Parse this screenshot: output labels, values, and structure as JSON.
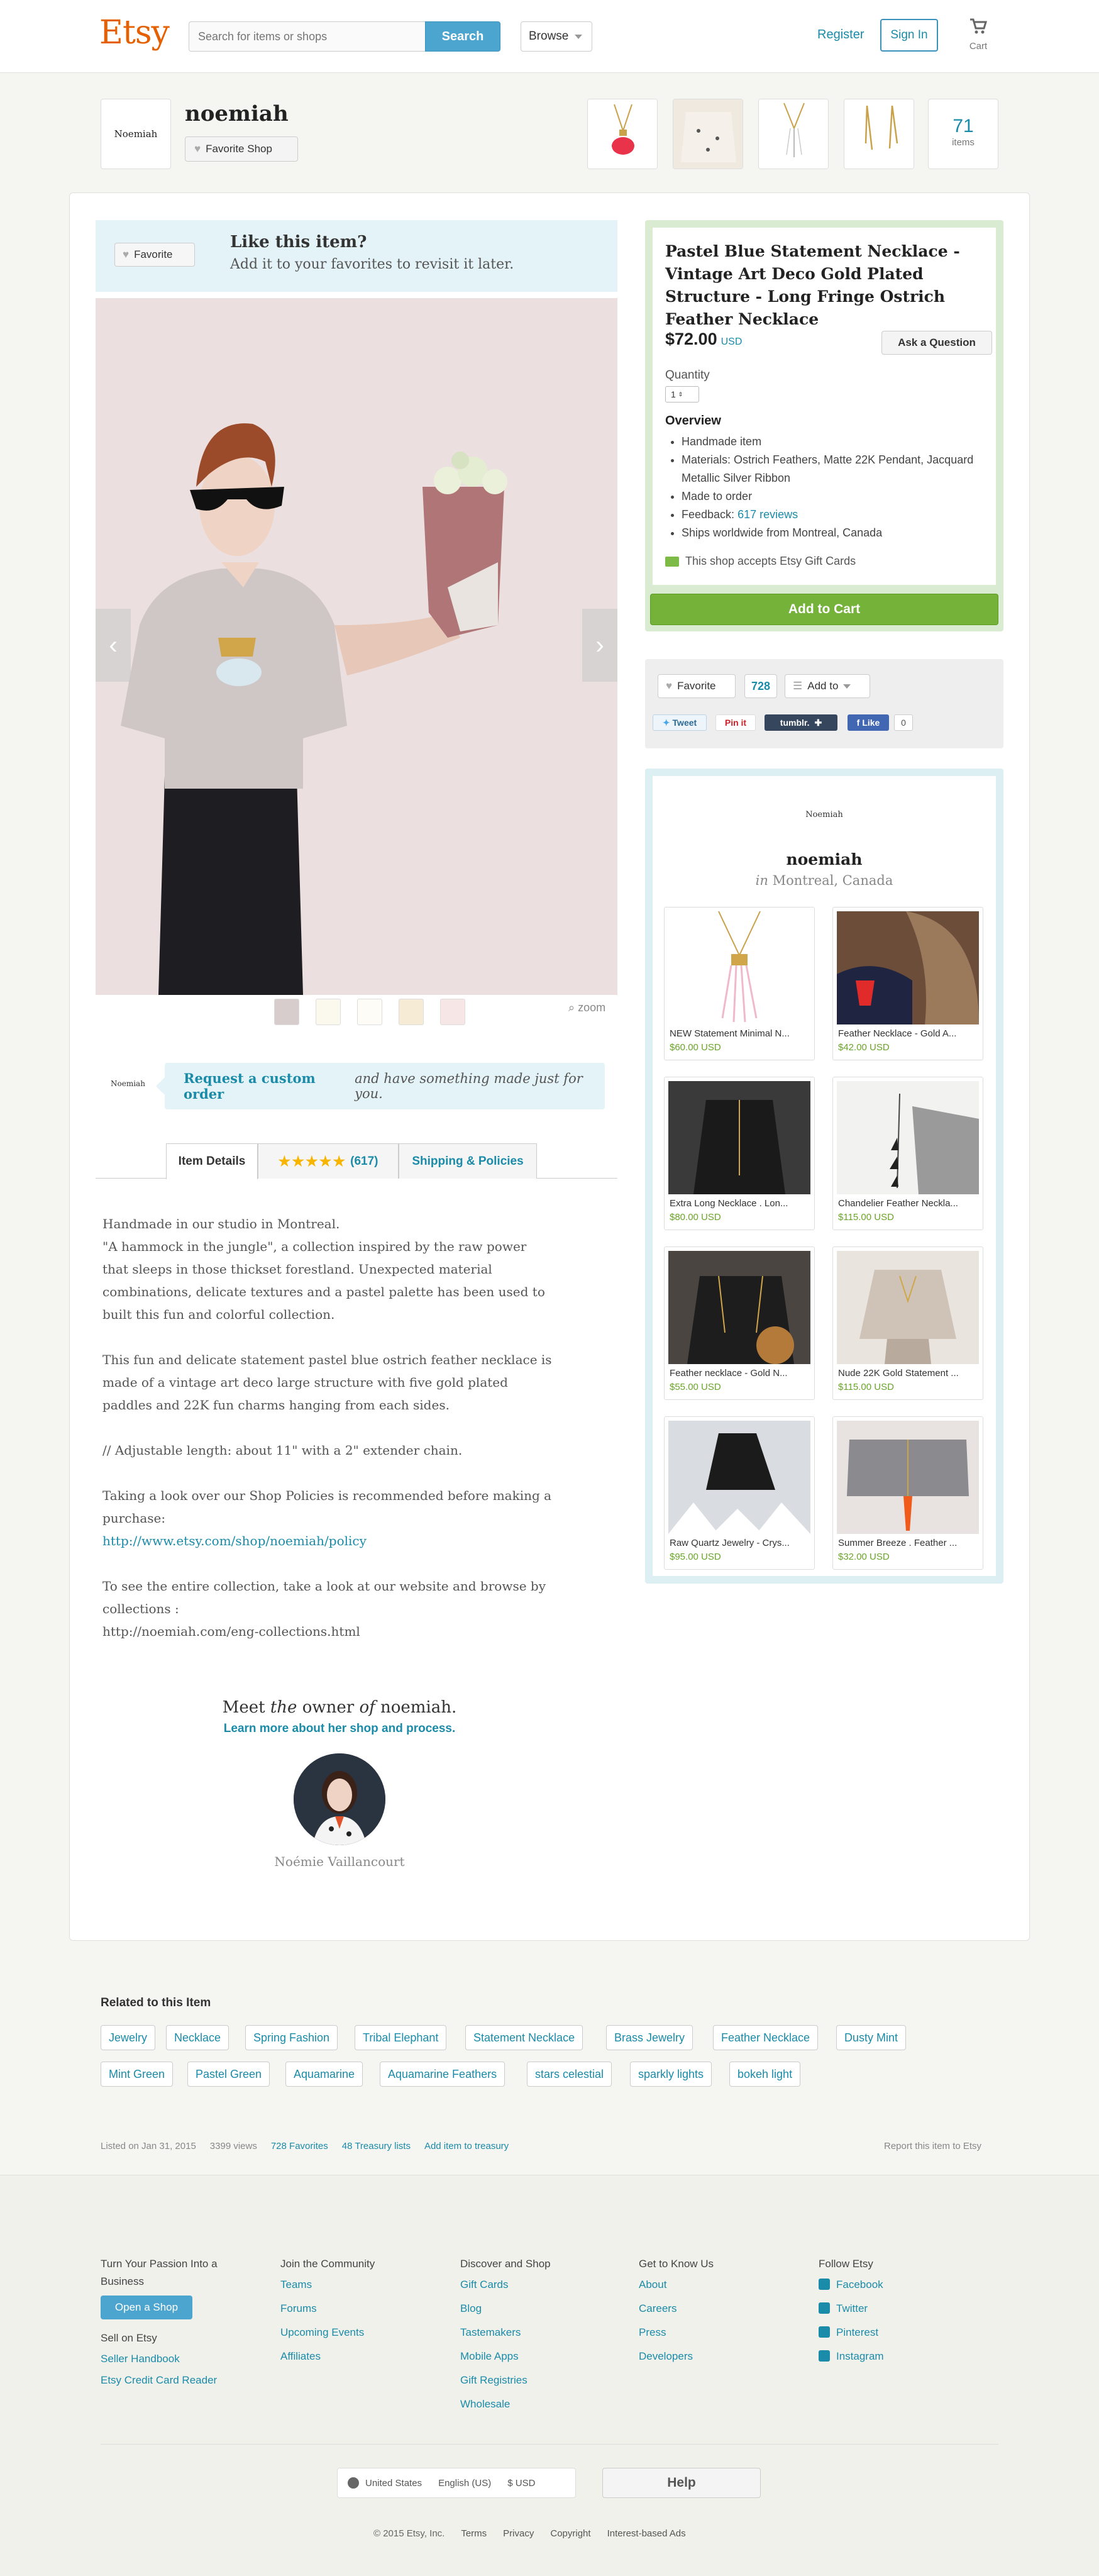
{
  "header": {
    "logo": "Etsy",
    "search_placeholder": "Search for items or shops",
    "search_button": "Search",
    "browse": "Browse",
    "register": "Register",
    "sign_in": "Sign In",
    "cart": "Cart"
  },
  "shop": {
    "logo_text": "Noemiah",
    "name": "noemiah",
    "favorite_shop": "Favorite Shop",
    "items_count": "71",
    "items_label": "items"
  },
  "like_box": {
    "favorite": "Favorite",
    "heading": "Like this item?",
    "subtext": "Add it to your favorites to revisit it later."
  },
  "gallery": {
    "zoom": "zoom"
  },
  "custom_order": {
    "logo_text": "Noemiah",
    "link": "Request a custom order",
    "rest": "and have something made just for you."
  },
  "tabs": {
    "details": "Item Details",
    "reviews": "(617)",
    "policies": "Shipping & Policies"
  },
  "description": {
    "p1": "Handmade in our studio in Montreal.\n\"A hammock in the jungle\", a collection inspired by the raw power that sleeps in those thickset forestland. Unexpected material combinations, delicate textures and a pastel palette has been used to built this fun and colorful collection.",
    "p2": "This fun and delicate statement pastel blue ostrich feather necklace is made of a vintage art deco large structure with five gold plated paddles and 22K fun charms hanging from each sides.",
    "p3": "// Adjustable length: about 11\" with a 2\" extender chain.",
    "p4": "Taking a look over our Shop Policies is recommended before making a purchase:",
    "p4_link": "http://www.etsy.com/shop/noemiah/policy",
    "p5": "To see the entire collection, take a look at our website and browse by collections :\nhttp://noemiah.com/eng-collections.html"
  },
  "owner": {
    "heading_pre": "Meet",
    "heading_the": "the",
    "heading_owner": "owner",
    "heading_of": "of",
    "heading_shop": "noemiah.",
    "link": "Learn more about her shop and process.",
    "name": "Noémie Vaillancourt"
  },
  "product": {
    "title": "Pastel Blue Statement Necklace - Vintage Art Deco Gold Plated Structure - Long Fringe Ostrich Feather Necklace",
    "price": "$72.00",
    "currency": "USD",
    "ask_question": "Ask a Question",
    "quantity_label": "Quantity",
    "quantity_value": "1",
    "overview_heading": "Overview",
    "overview": {
      "i1": "Handmade item",
      "i2": "Materials: Ostrich Feathers, Matte 22K Pendant, Jacquard Metallic Silver Ribbon",
      "i3": "Made to order",
      "i4_pre": "Feedback: ",
      "i4_link": "617 reviews",
      "i5": "Ships worldwide from Montreal, Canada"
    },
    "gift_cards": "This shop accepts Etsy Gift Cards",
    "add_to_cart": "Add to Cart"
  },
  "social": {
    "favorite": "Favorite",
    "favorite_count": "728",
    "add_to": "Add to",
    "tweet": "Tweet",
    "pin": "Pin it",
    "tumblr": "tumblr.",
    "like": "Like",
    "like_count": "0"
  },
  "shop_box": {
    "logo_text": "Noemiah",
    "name": "noemiah",
    "location_in": "in",
    "location": "Montreal, Canada",
    "items": [
      {
        "title": "NEW Statement Minimal N...",
        "price": "$60.00 USD"
      },
      {
        "title": "Feather Necklace - Gold A...",
        "price": "$42.00 USD"
      },
      {
        "title": "Extra Long Necklace . Lon...",
        "price": "$80.00 USD"
      },
      {
        "title": "Chandelier Feather Neckla...",
        "price": "$115.00 USD"
      },
      {
        "title": "Feather necklace - Gold N...",
        "price": "$55.00 USD"
      },
      {
        "title": "Nude 22K Gold Statement ...",
        "price": "$115.00 USD"
      },
      {
        "title": "Raw Quartz Jewelry - Crys...",
        "price": "$95.00 USD"
      },
      {
        "title": "Summer Breeze . Feather ...",
        "price": "$32.00 USD"
      }
    ]
  },
  "related": {
    "heading": "Related to this Item",
    "tags": [
      "Jewelry",
      "Necklace",
      "Spring Fashion",
      "Tribal Elephant",
      "Statement Necklace",
      "Brass Jewelry",
      "Feather Necklace",
      "Dusty Mint",
      "Mint Green",
      "Pastel Green",
      "Aquamarine",
      "Aquamarine Feathers",
      "stars celestial",
      "sparkly lights",
      "bokeh light"
    ]
  },
  "listing_meta": {
    "listed": "Listed on Jan 31, 2015",
    "views": "3399 views",
    "favorites": "728 Favorites",
    "treasury": "48 Treasury lists",
    "add_treasury": "Add item to treasury",
    "report": "Report this item to Etsy"
  },
  "footer": {
    "col1_heading": "Turn Your Passion Into a Business",
    "open_shop": "Open a Shop",
    "sell_heading": "Sell on Etsy",
    "col1_links": [
      "Seller Handbook",
      "Etsy Credit Card Reader"
    ],
    "col2_heading": "Join the Community",
    "col2_links": [
      "Teams",
      "Forums",
      "Upcoming Events",
      "Affiliates"
    ],
    "col3_heading": "Discover and Shop",
    "col3_links": [
      "Gift Cards",
      "Blog",
      "Tastemakers",
      "Mobile Apps",
      "Gift Registries",
      "Wholesale"
    ],
    "col4_heading": "Get to Know Us",
    "col4_links": [
      "About",
      "Careers",
      "Press",
      "Developers"
    ],
    "col5_heading": "Follow Etsy",
    "col5_links": [
      "Facebook",
      "Twitter",
      "Pinterest",
      "Instagram"
    ],
    "country": "United States",
    "language": "English (US)",
    "currency": "$ USD",
    "help": "Help",
    "copyright": "© 2015 Etsy, Inc.",
    "terms": "Terms",
    "privacy": "Privacy",
    "copyright_link": "Copyright",
    "ads": "Interest-based Ads"
  },
  "colors": {
    "brand": "#e56000",
    "link": "#1a8ba8",
    "cart_green": "#75b23a",
    "price_green": "#6aa429"
  }
}
